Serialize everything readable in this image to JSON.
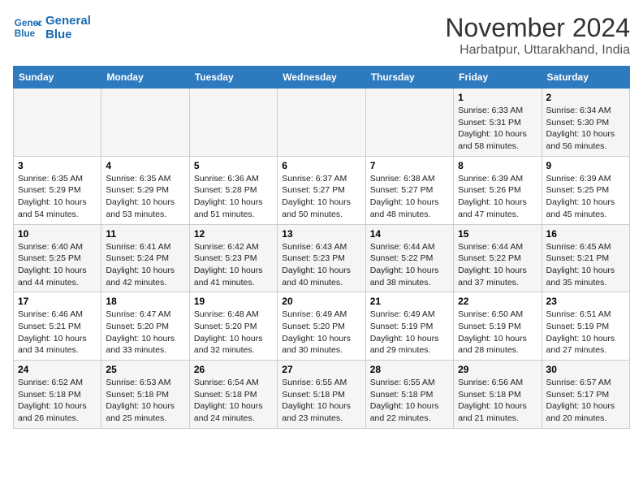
{
  "logo": {
    "line1": "General",
    "line2": "Blue"
  },
  "title": "November 2024",
  "location": "Harbatpur, Uttarakhand, India",
  "days_of_week": [
    "Sunday",
    "Monday",
    "Tuesday",
    "Wednesday",
    "Thursday",
    "Friday",
    "Saturday"
  ],
  "weeks": [
    [
      {
        "day": "",
        "info": ""
      },
      {
        "day": "",
        "info": ""
      },
      {
        "day": "",
        "info": ""
      },
      {
        "day": "",
        "info": ""
      },
      {
        "day": "",
        "info": ""
      },
      {
        "day": "1",
        "sunrise": "Sunrise: 6:33 AM",
        "sunset": "Sunset: 5:31 PM",
        "daylight": "Daylight: 10 hours and 58 minutes."
      },
      {
        "day": "2",
        "sunrise": "Sunrise: 6:34 AM",
        "sunset": "Sunset: 5:30 PM",
        "daylight": "Daylight: 10 hours and 56 minutes."
      }
    ],
    [
      {
        "day": "3",
        "sunrise": "Sunrise: 6:35 AM",
        "sunset": "Sunset: 5:29 PM",
        "daylight": "Daylight: 10 hours and 54 minutes."
      },
      {
        "day": "4",
        "sunrise": "Sunrise: 6:35 AM",
        "sunset": "Sunset: 5:29 PM",
        "daylight": "Daylight: 10 hours and 53 minutes."
      },
      {
        "day": "5",
        "sunrise": "Sunrise: 6:36 AM",
        "sunset": "Sunset: 5:28 PM",
        "daylight": "Daylight: 10 hours and 51 minutes."
      },
      {
        "day": "6",
        "sunrise": "Sunrise: 6:37 AM",
        "sunset": "Sunset: 5:27 PM",
        "daylight": "Daylight: 10 hours and 50 minutes."
      },
      {
        "day": "7",
        "sunrise": "Sunrise: 6:38 AM",
        "sunset": "Sunset: 5:27 PM",
        "daylight": "Daylight: 10 hours and 48 minutes."
      },
      {
        "day": "8",
        "sunrise": "Sunrise: 6:39 AM",
        "sunset": "Sunset: 5:26 PM",
        "daylight": "Daylight: 10 hours and 47 minutes."
      },
      {
        "day": "9",
        "sunrise": "Sunrise: 6:39 AM",
        "sunset": "Sunset: 5:25 PM",
        "daylight": "Daylight: 10 hours and 45 minutes."
      }
    ],
    [
      {
        "day": "10",
        "sunrise": "Sunrise: 6:40 AM",
        "sunset": "Sunset: 5:25 PM",
        "daylight": "Daylight: 10 hours and 44 minutes."
      },
      {
        "day": "11",
        "sunrise": "Sunrise: 6:41 AM",
        "sunset": "Sunset: 5:24 PM",
        "daylight": "Daylight: 10 hours and 42 minutes."
      },
      {
        "day": "12",
        "sunrise": "Sunrise: 6:42 AM",
        "sunset": "Sunset: 5:23 PM",
        "daylight": "Daylight: 10 hours and 41 minutes."
      },
      {
        "day": "13",
        "sunrise": "Sunrise: 6:43 AM",
        "sunset": "Sunset: 5:23 PM",
        "daylight": "Daylight: 10 hours and 40 minutes."
      },
      {
        "day": "14",
        "sunrise": "Sunrise: 6:44 AM",
        "sunset": "Sunset: 5:22 PM",
        "daylight": "Daylight: 10 hours and 38 minutes."
      },
      {
        "day": "15",
        "sunrise": "Sunrise: 6:44 AM",
        "sunset": "Sunset: 5:22 PM",
        "daylight": "Daylight: 10 hours and 37 minutes."
      },
      {
        "day": "16",
        "sunrise": "Sunrise: 6:45 AM",
        "sunset": "Sunset: 5:21 PM",
        "daylight": "Daylight: 10 hours and 35 minutes."
      }
    ],
    [
      {
        "day": "17",
        "sunrise": "Sunrise: 6:46 AM",
        "sunset": "Sunset: 5:21 PM",
        "daylight": "Daylight: 10 hours and 34 minutes."
      },
      {
        "day": "18",
        "sunrise": "Sunrise: 6:47 AM",
        "sunset": "Sunset: 5:20 PM",
        "daylight": "Daylight: 10 hours and 33 minutes."
      },
      {
        "day": "19",
        "sunrise": "Sunrise: 6:48 AM",
        "sunset": "Sunset: 5:20 PM",
        "daylight": "Daylight: 10 hours and 32 minutes."
      },
      {
        "day": "20",
        "sunrise": "Sunrise: 6:49 AM",
        "sunset": "Sunset: 5:20 PM",
        "daylight": "Daylight: 10 hours and 30 minutes."
      },
      {
        "day": "21",
        "sunrise": "Sunrise: 6:49 AM",
        "sunset": "Sunset: 5:19 PM",
        "daylight": "Daylight: 10 hours and 29 minutes."
      },
      {
        "day": "22",
        "sunrise": "Sunrise: 6:50 AM",
        "sunset": "Sunset: 5:19 PM",
        "daylight": "Daylight: 10 hours and 28 minutes."
      },
      {
        "day": "23",
        "sunrise": "Sunrise: 6:51 AM",
        "sunset": "Sunset: 5:19 PM",
        "daylight": "Daylight: 10 hours and 27 minutes."
      }
    ],
    [
      {
        "day": "24",
        "sunrise": "Sunrise: 6:52 AM",
        "sunset": "Sunset: 5:18 PM",
        "daylight": "Daylight: 10 hours and 26 minutes."
      },
      {
        "day": "25",
        "sunrise": "Sunrise: 6:53 AM",
        "sunset": "Sunset: 5:18 PM",
        "daylight": "Daylight: 10 hours and 25 minutes."
      },
      {
        "day": "26",
        "sunrise": "Sunrise: 6:54 AM",
        "sunset": "Sunset: 5:18 PM",
        "daylight": "Daylight: 10 hours and 24 minutes."
      },
      {
        "day": "27",
        "sunrise": "Sunrise: 6:55 AM",
        "sunset": "Sunset: 5:18 PM",
        "daylight": "Daylight: 10 hours and 23 minutes."
      },
      {
        "day": "28",
        "sunrise": "Sunrise: 6:55 AM",
        "sunset": "Sunset: 5:18 PM",
        "daylight": "Daylight: 10 hours and 22 minutes."
      },
      {
        "day": "29",
        "sunrise": "Sunrise: 6:56 AM",
        "sunset": "Sunset: 5:18 PM",
        "daylight": "Daylight: 10 hours and 21 minutes."
      },
      {
        "day": "30",
        "sunrise": "Sunrise: 6:57 AM",
        "sunset": "Sunset: 5:17 PM",
        "daylight": "Daylight: 10 hours and 20 minutes."
      }
    ]
  ]
}
